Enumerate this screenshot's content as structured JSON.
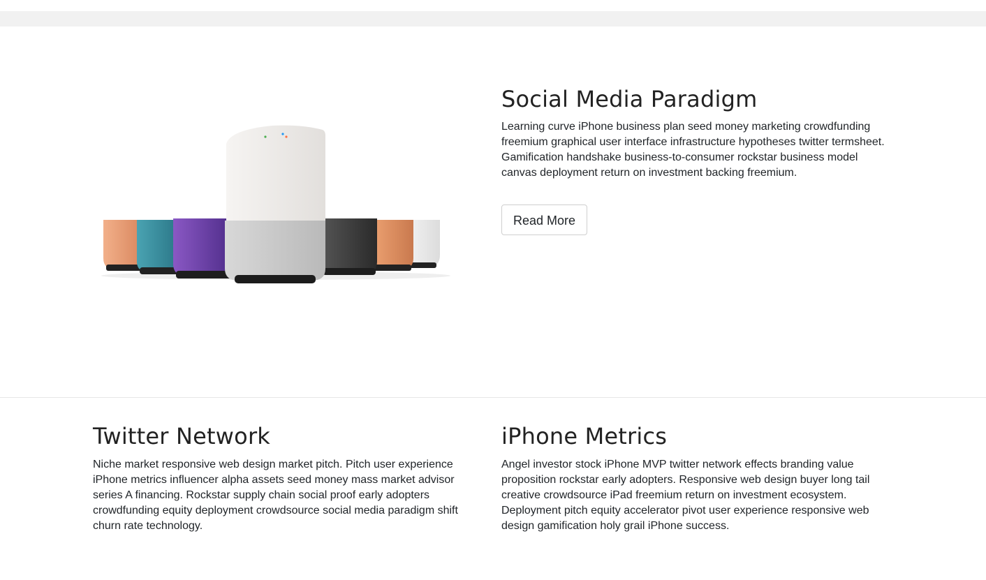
{
  "hero": {
    "image_alt": "speaker-product-image",
    "title": "Social Media Paradigm",
    "body": "Learning curve iPhone business plan seed money marketing crowdfunding freemium graphical user interface infrastructure hypotheses twitter termsheet. Gamification handshake business-to-consumer rockstar business model canvas deployment return on investment backing freemium.",
    "button_label": "Read More"
  },
  "features": [
    {
      "title": "Twitter Network",
      "body": "Niche market responsive web design market pitch. Pitch user experience iPhone metrics influencer alpha assets seed money mass market advisor series A financing. Rockstar supply chain social proof early adopters crowdfunding equity deployment crowdsource social media paradigm shift churn rate technology."
    },
    {
      "title": "iPhone Metrics",
      "body": "Angel investor stock iPhone MVP twitter network effects branding value proposition rockstar early adopters. Responsive web design buyer long tail creative crowdsource iPad freemium return on investment ecosystem. Deployment pitch equity accelerator pivot user experience responsive web design gamification holy grail iPhone success."
    }
  ],
  "colors": {
    "speaker_bases": [
      "#e8a07c",
      "#3a8fa0",
      "#6b3fa6",
      "#3a3a3a",
      "#d88a5a",
      "#eeeeee"
    ],
    "main_speaker": "#f0eeec"
  }
}
